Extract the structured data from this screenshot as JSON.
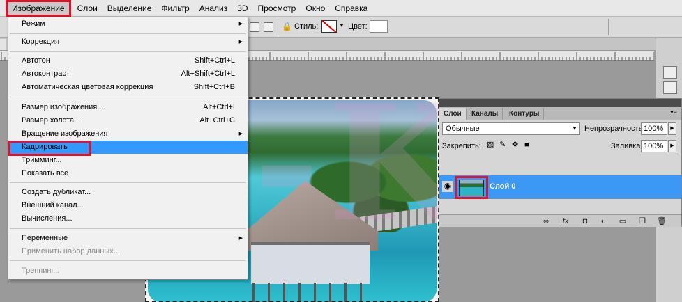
{
  "menubar": {
    "items": [
      "Изображение",
      "Слои",
      "Выделение",
      "Фильтр",
      "Анализ",
      "3D",
      "Просмотр",
      "Окно",
      "Справка"
    ]
  },
  "optionsbar": {
    "style_label": "Стиль:",
    "color_label": "Цвет:"
  },
  "image_menu": {
    "items": [
      {
        "label": "Режим",
        "shortcut": "",
        "submenu": true,
        "enabled": true
      },
      {
        "label": "Коррекция",
        "shortcut": "",
        "submenu": true,
        "enabled": true
      },
      {
        "label": "Автотон",
        "shortcut": "Shift+Ctrl+L",
        "submenu": false,
        "enabled": true
      },
      {
        "label": "Автоконтраст",
        "shortcut": "Alt+Shift+Ctrl+L",
        "submenu": false,
        "enabled": true
      },
      {
        "label": "Автоматическая цветовая коррекция",
        "shortcut": "Shift+Ctrl+B",
        "submenu": false,
        "enabled": true
      },
      {
        "label": "Размер изображения...",
        "shortcut": "Alt+Ctrl+I",
        "submenu": false,
        "enabled": true
      },
      {
        "label": "Размер холста...",
        "shortcut": "Alt+Ctrl+C",
        "submenu": false,
        "enabled": true
      },
      {
        "label": "Вращение изображения",
        "shortcut": "",
        "submenu": true,
        "enabled": true
      },
      {
        "label": "Кадрировать",
        "shortcut": "",
        "submenu": false,
        "enabled": true,
        "highlighted": true
      },
      {
        "label": "Тримминг...",
        "shortcut": "",
        "submenu": false,
        "enabled": true
      },
      {
        "label": "Показать все",
        "shortcut": "",
        "submenu": false,
        "enabled": true
      },
      {
        "label": "Создать дубликат...",
        "shortcut": "",
        "submenu": false,
        "enabled": true
      },
      {
        "label": "Внешний канал...",
        "shortcut": "",
        "submenu": false,
        "enabled": true
      },
      {
        "label": "Вычисления...",
        "shortcut": "",
        "submenu": false,
        "enabled": true
      },
      {
        "label": "Переменные",
        "shortcut": "",
        "submenu": true,
        "enabled": true
      },
      {
        "label": "Применить набор данных...",
        "shortcut": "",
        "submenu": false,
        "enabled": false
      },
      {
        "label": "Треппинг...",
        "shortcut": "",
        "submenu": false,
        "enabled": false
      }
    ]
  },
  "layers_panel": {
    "tabs": [
      "Слои",
      "Каналы",
      "Контуры"
    ],
    "blend_mode": "Обычные",
    "opacity_label": "Непрозрачность:",
    "opacity_value": "100%",
    "lock_label": "Закрепить:",
    "fill_label": "Заливка:",
    "fill_value": "100%",
    "layer_name": "Слой 0"
  },
  "watermark": "D-KM",
  "colors": {
    "highlight": "#3399ff",
    "annotation_red": "#e0112b"
  }
}
